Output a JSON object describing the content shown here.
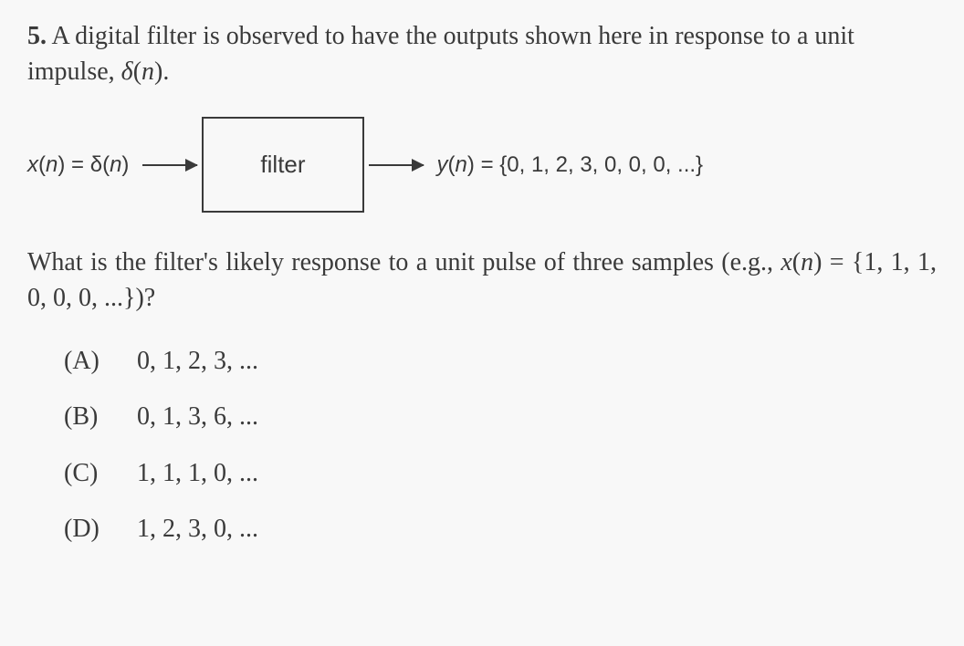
{
  "problem": {
    "number": "5.",
    "intro_text_1": " A digital filter is observed to have the outputs shown here in response to a unit impulse, ",
    "delta": "δ",
    "n_in_paren": "(n).",
    "n_var": "n"
  },
  "diagram": {
    "input_prefix": "x",
    "input_open": "(",
    "input_n": "n",
    "input_close": ") = δ(",
    "input_n2": "n",
    "input_close2": ")",
    "filter_label": "filter",
    "output_prefix": "y",
    "output_open": "(",
    "output_n": "n",
    "output_close": ") = {0, 1, 2, 3, 0, 0, 0, ...}"
  },
  "question": {
    "text_1": "What is the filter's likely response to a unit pulse of three samples (e.g., ",
    "x_var": "x",
    "paren_open": "(",
    "n_var": "n",
    "middle": ") = {1, 1, 1, 0, 0, 0, ...})?"
  },
  "choices": {
    "a": {
      "label": "(A)",
      "value": "0, 1, 2, 3, ..."
    },
    "b": {
      "label": "(B)",
      "value": "0, 1, 3, 6, ..."
    },
    "c": {
      "label": "(C)",
      "value": "1, 1, 1, 0, ..."
    },
    "d": {
      "label": "(D)",
      "value": "1, 2, 3, 0, ..."
    }
  }
}
